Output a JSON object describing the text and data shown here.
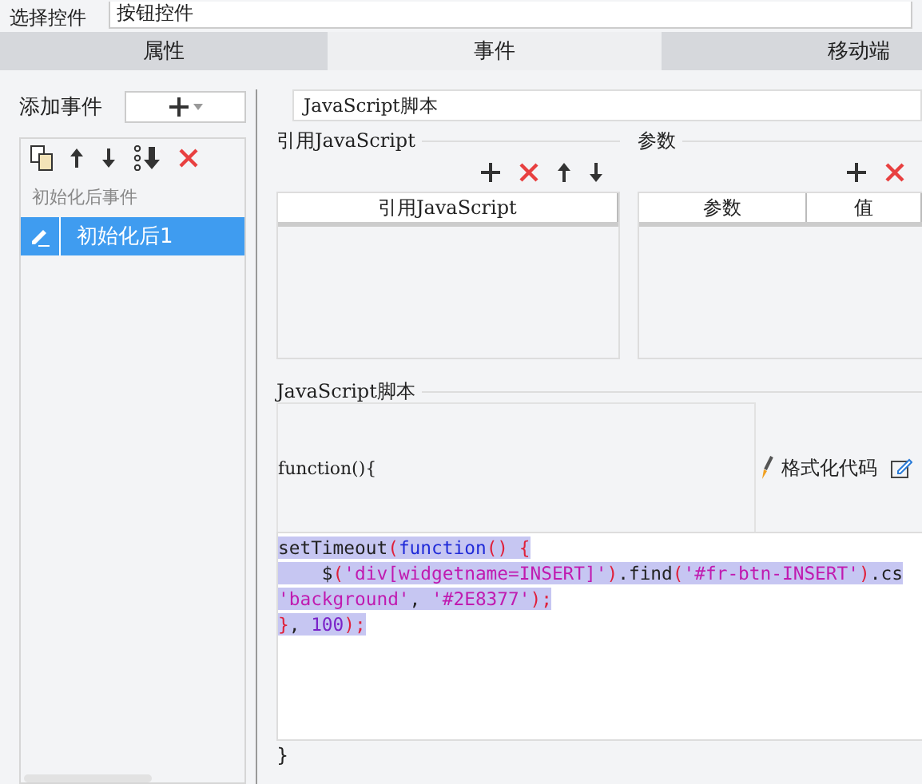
{
  "top_bar": {
    "label": "选择控件",
    "value": "按钮控件"
  },
  "tabs": [
    {
      "label": "属性",
      "selected": false
    },
    {
      "label": "事件",
      "selected": true
    },
    {
      "label": "移动端",
      "selected": false
    }
  ],
  "events": {
    "label": "添加事件",
    "groups": [
      {
        "title": "初始化后事件",
        "items": [
          {
            "label": "初始化后1",
            "selected": true
          }
        ]
      }
    ]
  },
  "script_type": {
    "value": "JavaScript脚本"
  },
  "ref_section": {
    "title": "引用JavaScript",
    "columns": [
      "引用JavaScript"
    ]
  },
  "param_section": {
    "title": "参数",
    "columns": [
      "参数",
      "值"
    ]
  },
  "script_section": {
    "title": "JavaScript脚本",
    "header": "function(){",
    "format_button": "格式化代码",
    "footer": "}",
    "code": [
      {
        "selected": true,
        "tokens": [
          {
            "kind": "plain",
            "text": "setTimeout"
          },
          {
            "kind": "punct",
            "text": "("
          },
          {
            "kind": "keyword",
            "text": "function"
          },
          {
            "kind": "punct",
            "text": "() {"
          }
        ]
      },
      {
        "selected": true,
        "tokens": [
          {
            "kind": "plain",
            "text": "    $"
          },
          {
            "kind": "punct",
            "text": "("
          },
          {
            "kind": "string",
            "text": "'div[widgetname=INSERT]'"
          },
          {
            "kind": "punct",
            "text": ")"
          },
          {
            "kind": "plain",
            "text": ".find"
          },
          {
            "kind": "punct",
            "text": "("
          },
          {
            "kind": "string",
            "text": "'#fr-btn-INSERT'"
          },
          {
            "kind": "punct",
            "text": ")"
          },
          {
            "kind": "plain",
            "text": ".cs"
          }
        ]
      },
      {
        "selected": true,
        "tokens": [
          {
            "kind": "string",
            "text": "'background'"
          },
          {
            "kind": "plain",
            "text": ", "
          },
          {
            "kind": "string",
            "text": "'#2E8377'"
          },
          {
            "kind": "punct",
            "text": ");"
          }
        ]
      },
      {
        "selected": true,
        "tokens": [
          {
            "kind": "punct",
            "text": "}"
          },
          {
            "kind": "plain",
            "text": ", "
          },
          {
            "kind": "number",
            "text": "100"
          },
          {
            "kind": "punct",
            "text": ");"
          }
        ]
      }
    ]
  }
}
